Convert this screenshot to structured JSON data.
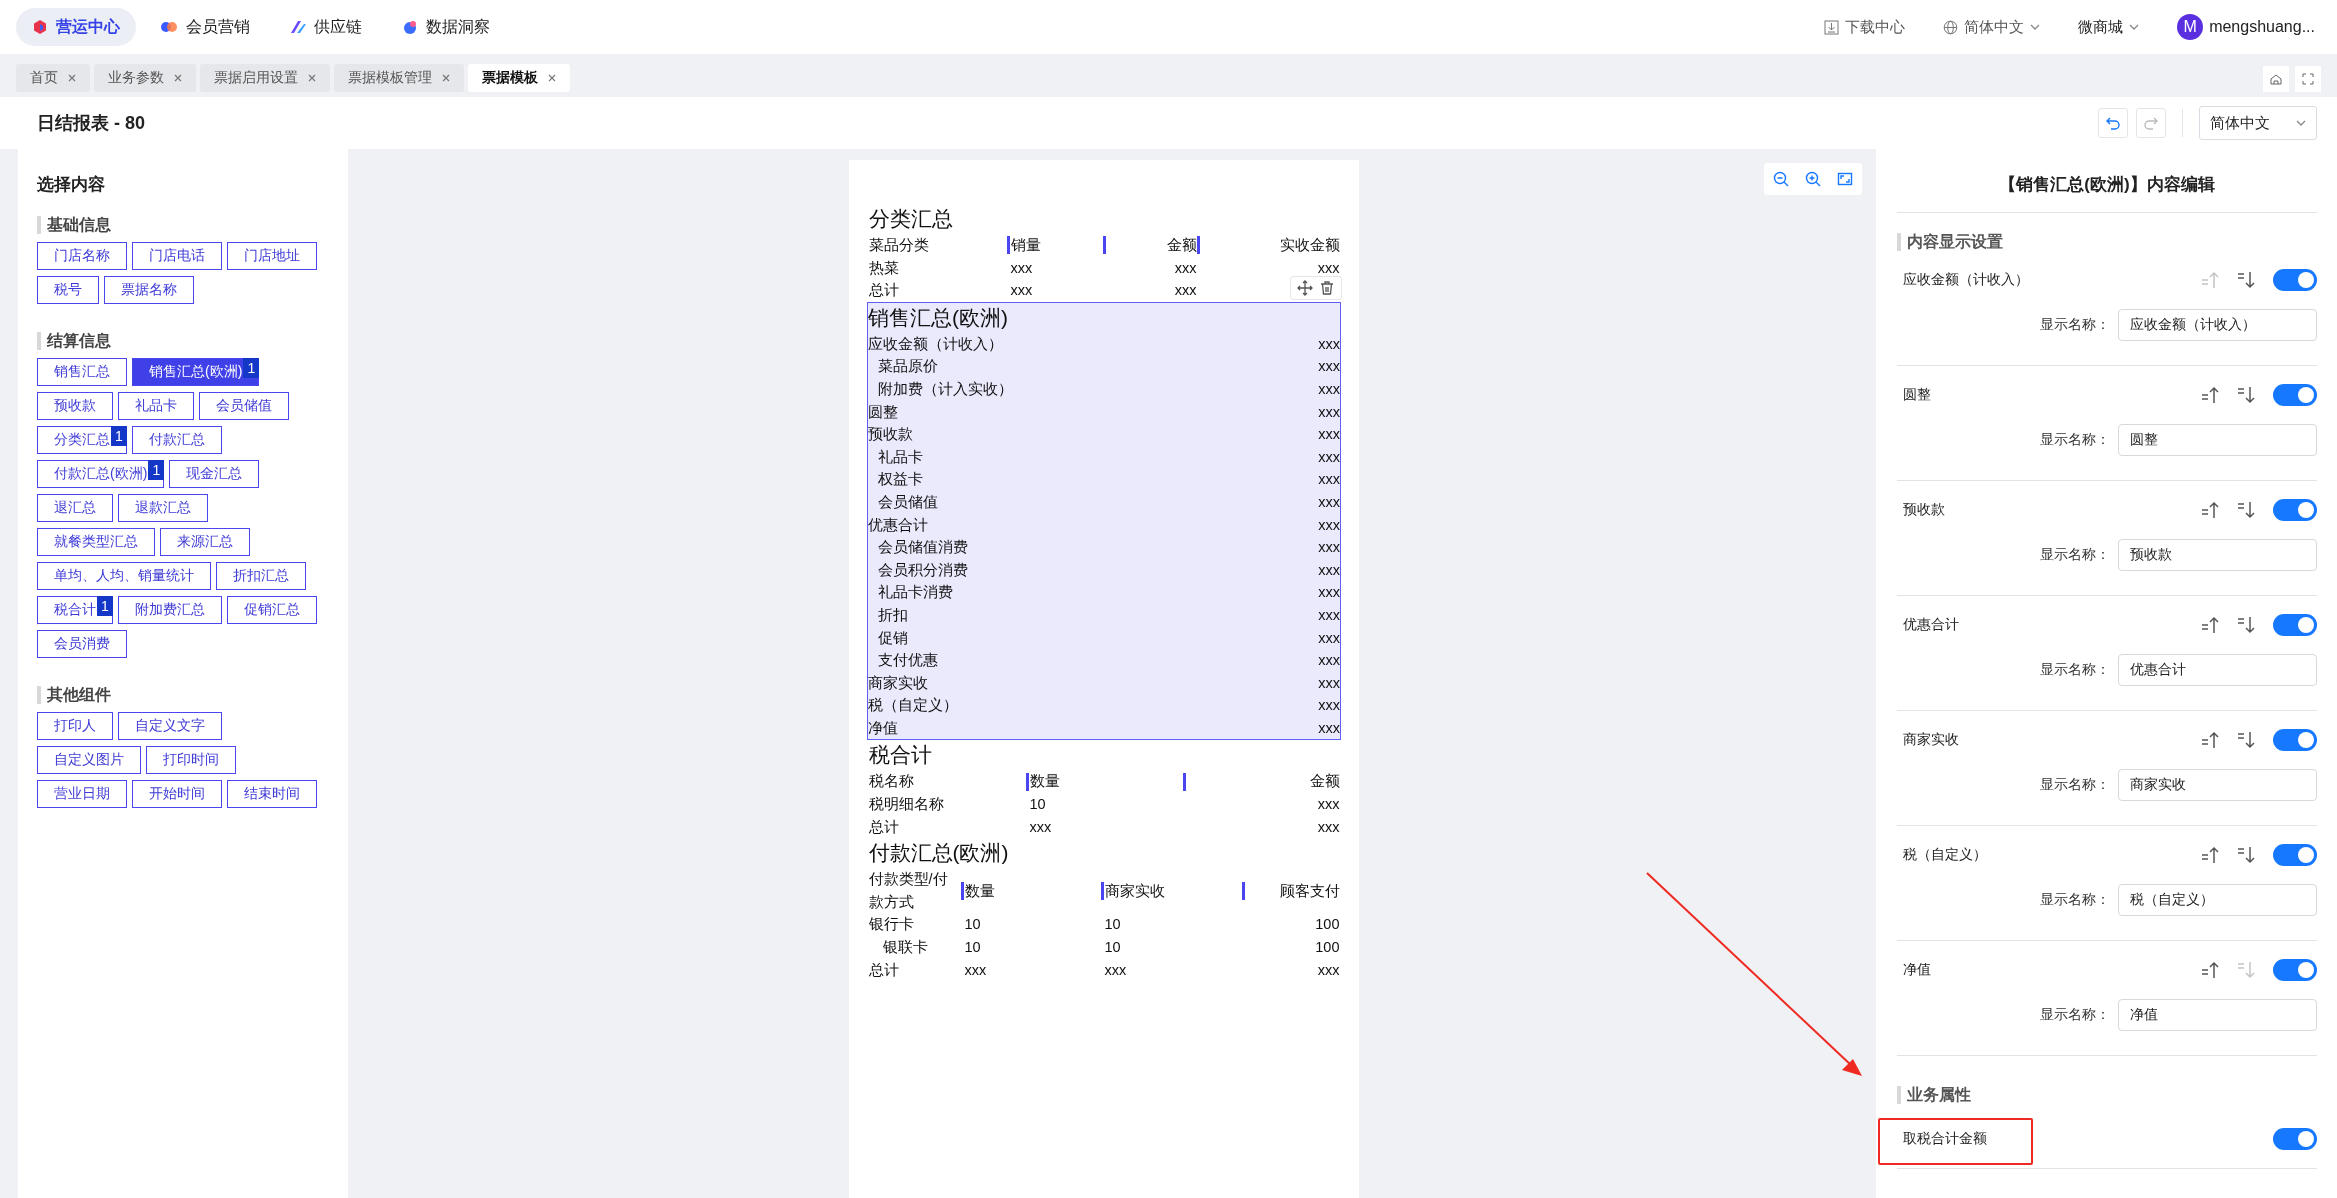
{
  "top_nav": {
    "modules": [
      {
        "label": "营运中心",
        "selected": true
      },
      {
        "label": "会员营销",
        "selected": false
      },
      {
        "label": "供应链",
        "selected": false
      },
      {
        "label": "数据洞察",
        "selected": false
      }
    ],
    "download": "下载中心",
    "language": "简体中文",
    "store": "微商城",
    "user": {
      "initial": "M",
      "name": "mengshuang..."
    }
  },
  "tabs": [
    {
      "label": "首页",
      "selected": false
    },
    {
      "label": "业务参数",
      "selected": false
    },
    {
      "label": "票据启用设置",
      "selected": false
    },
    {
      "label": "票据模板管理",
      "selected": false
    },
    {
      "label": "票据模板",
      "selected": true
    }
  ],
  "header": {
    "title": "日结报表 - 80",
    "undo_enabled": true,
    "redo_enabled": false,
    "language": "简体中文"
  },
  "content_picker": {
    "title": "选择内容",
    "groups": [
      {
        "title": "基础信息",
        "items": [
          {
            "label": "门店名称",
            "selected": false
          },
          {
            "label": "门店电话",
            "selected": false
          },
          {
            "label": "门店地址",
            "selected": false
          },
          {
            "label": "税号",
            "selected": false
          },
          {
            "label": "票据名称",
            "selected": false
          }
        ]
      },
      {
        "title": "结算信息",
        "items": [
          {
            "label": "销售汇总",
            "selected": false
          },
          {
            "label": "销售汇总(欧洲)",
            "selected": true,
            "badge": "1"
          },
          {
            "label": "预收款",
            "selected": false
          },
          {
            "label": "礼品卡",
            "selected": false
          },
          {
            "label": "会员储值",
            "selected": false
          },
          {
            "label": "分类汇总",
            "selected": false,
            "badge": "1"
          },
          {
            "label": "付款汇总",
            "selected": false
          },
          {
            "label": "付款汇总(欧洲)",
            "selected": false,
            "badge": "1"
          },
          {
            "label": "现金汇总",
            "selected": false
          },
          {
            "label": "退汇总",
            "selected": false
          },
          {
            "label": "退款汇总",
            "selected": false
          },
          {
            "label": "就餐类型汇总",
            "selected": false
          },
          {
            "label": "来源汇总",
            "selected": false
          },
          {
            "label": "单均、人均、销量统计",
            "selected": false
          },
          {
            "label": "折扣汇总",
            "selected": false
          },
          {
            "label": "税合计",
            "selected": false,
            "badge": "1"
          },
          {
            "label": "附加费汇总",
            "selected": false
          },
          {
            "label": "促销汇总",
            "selected": false
          },
          {
            "label": "会员消费",
            "selected": false
          }
        ]
      },
      {
        "title": "其他组件",
        "items": [
          {
            "label": "打印人",
            "selected": false
          },
          {
            "label": "自定义文字",
            "selected": false
          },
          {
            "label": "自定义图片",
            "selected": false
          },
          {
            "label": "打印时间",
            "selected": false
          },
          {
            "label": "营业日期",
            "selected": false
          },
          {
            "label": "开始时间",
            "selected": false
          },
          {
            "label": "结束时间",
            "selected": false
          }
        ]
      }
    ]
  },
  "document": {
    "sections": [
      {
        "kind": "table",
        "title": "分类汇总",
        "selected": false,
        "columns": [
          "菜品分类",
          "销量",
          "金额",
          "实收金额"
        ],
        "rows": [
          {
            "cells": [
              "热菜",
              "xxx",
              "xxx",
              "xxx"
            ]
          },
          {
            "cells": [
              "总计",
              "xxx",
              "xxx"
            ]
          }
        ]
      },
      {
        "kind": "list",
        "title": "销售汇总(欧洲)",
        "selected": true,
        "items": [
          {
            "label": "应收金额（计收入）",
            "value": "xxx",
            "children": [
              {
                "label": "菜品原价",
                "value": "xxx"
              },
              {
                "label": "附加费（计入实收）",
                "value": "xxx"
              }
            ]
          },
          {
            "label": "圆整",
            "value": "xxx"
          },
          {
            "label": "预收款",
            "value": "xxx",
            "children": [
              {
                "label": "礼品卡",
                "value": "xxx"
              },
              {
                "label": "权益卡",
                "value": "xxx"
              },
              {
                "label": "会员储值",
                "value": "xxx"
              }
            ]
          },
          {
            "label": "优惠合计",
            "value": "xxx",
            "children": [
              {
                "label": "会员储值消费",
                "value": "xxx"
              },
              {
                "label": "会员积分消费",
                "value": "xxx"
              },
              {
                "label": "礼品卡消费",
                "value": "xxx"
              },
              {
                "label": "折扣",
                "value": "xxx"
              },
              {
                "label": "促销",
                "value": "xxx"
              },
              {
                "label": "支付优惠",
                "value": "xxx"
              }
            ]
          },
          {
            "label": "商家实收",
            "value": "xxx"
          },
          {
            "label": "税（自定义）",
            "value": "xxx"
          },
          {
            "label": "净值",
            "value": "xxx"
          }
        ]
      },
      {
        "kind": "table",
        "title": "税合计",
        "selected": false,
        "columns": [
          "税名称",
          "数量",
          "金额"
        ],
        "rows": [
          {
            "cells": [
              "税明细名称",
              "10",
              "xxx"
            ]
          },
          {
            "cells": [
              "总计",
              "xxx",
              "xxx"
            ]
          }
        ]
      },
      {
        "kind": "table",
        "title": "付款汇总(欧洲)",
        "selected": false,
        "columns": [
          "付款类型/付款方式",
          "数量",
          "商家实收",
          "顾客支付"
        ],
        "rows": [
          {
            "cells": [
              "银行卡",
              "10",
              "10",
              "100"
            ],
            "children": [
              {
                "cells": [
                  "银联卡",
                  "10",
                  "10",
                  "100"
                ]
              }
            ]
          },
          {
            "cells": [
              "总计",
              "xxx",
              "xxx",
              "xxx"
            ]
          }
        ]
      }
    ]
  },
  "editor": {
    "title": "【销售汇总(欧洲)】内容编辑",
    "display_section": "内容显示设置",
    "items": [
      {
        "label": "应收金额（计收入）",
        "field_label": "显示名称：",
        "value": "应收金额（计收入）",
        "can_move_up": false,
        "can_move_down": true,
        "on": true
      },
      {
        "label": "圆整",
        "field_label": "显示名称：",
        "value": "圆整",
        "can_move_up": true,
        "can_move_down": true,
        "on": true
      },
      {
        "label": "预收款",
        "field_label": "显示名称：",
        "value": "预收款",
        "can_move_up": true,
        "can_move_down": true,
        "on": true
      },
      {
        "label": "优惠合计",
        "field_label": "显示名称：",
        "value": "优惠合计",
        "can_move_up": true,
        "can_move_down": true,
        "on": true
      },
      {
        "label": "商家实收",
        "field_label": "显示名称：",
        "value": "商家实收",
        "can_move_up": true,
        "can_move_down": true,
        "on": true
      },
      {
        "label": "税（自定义）",
        "field_label": "显示名称：",
        "value": "税（自定义）",
        "can_move_up": true,
        "can_move_down": true,
        "on": true
      },
      {
        "label": "净值",
        "field_label": "显示名称：",
        "value": "净值",
        "can_move_up": true,
        "can_move_down": false,
        "on": true
      }
    ],
    "business_section": "业务属性",
    "business_items": [
      {
        "label": "取税合计金额",
        "on": true,
        "annotated": true
      }
    ]
  }
}
